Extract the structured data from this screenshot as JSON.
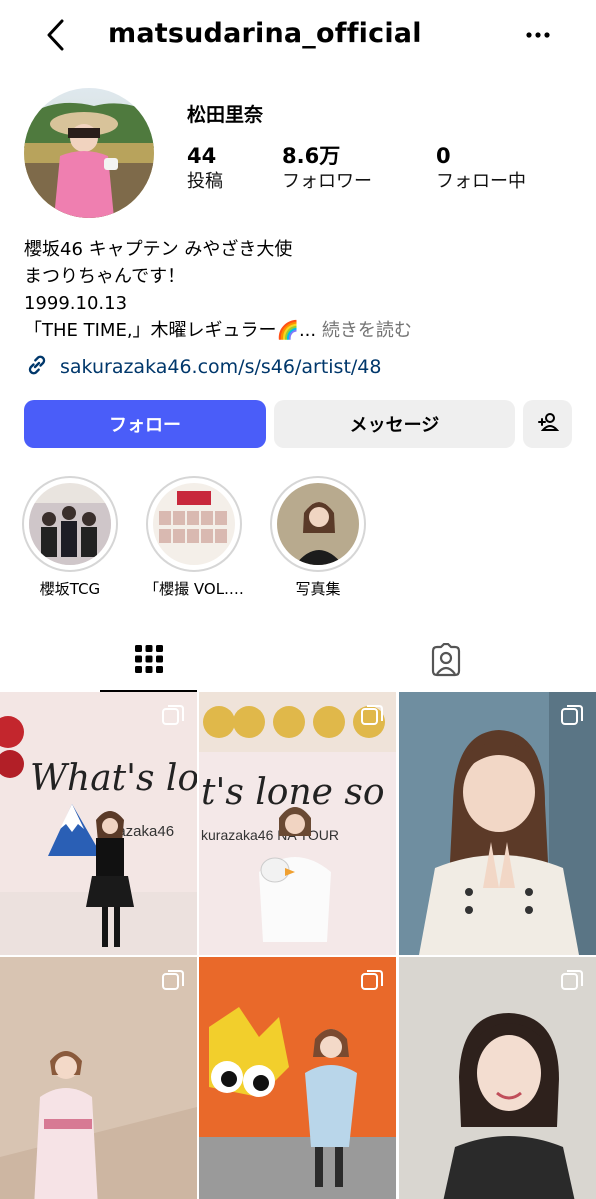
{
  "header": {
    "username": "matsudarina_official",
    "back_icon": "chevron-left-icon",
    "more_icon": "more-horizontal-icon"
  },
  "profile": {
    "display_name": "松田里奈",
    "stats": [
      {
        "value": "44",
        "label": "投稿"
      },
      {
        "value": "8.6万",
        "label": "フォロワー"
      },
      {
        "value": "0",
        "label": "フォロー中"
      }
    ],
    "bio_lines": [
      "櫻坂46 キャプテン みやざき大使",
      "まつりちゃんです！",
      "1999.10.13"
    ],
    "bio_last_line": "「THE TIME,」木曜レギュラー🌈...",
    "bio_more": "続きを読む",
    "link": "sakurazaka46.com/s/s46/artist/48"
  },
  "actions": {
    "follow": "フォロー",
    "message": "メッセージ",
    "add_person_icon": "add-person-icon"
  },
  "highlights": [
    {
      "label": "櫻坂TCG"
    },
    {
      "label": "「櫻撮 VOL.…"
    },
    {
      "label": "写真集"
    }
  ],
  "tabs": {
    "grid_icon": "grid-icon",
    "tagged_icon": "tagged-person-icon"
  },
  "posts": [
    {
      "overlay": "What's lo",
      "sub": "urazaka46",
      "multi": true
    },
    {
      "overlay": "t's lone so",
      "sub": "kurazaka46 NA TOUR",
      "multi": true
    },
    {
      "overlay": "",
      "sub": "",
      "multi": true
    },
    {
      "overlay": "",
      "sub": "",
      "multi": true
    },
    {
      "overlay": "",
      "sub": "",
      "multi": true
    },
    {
      "overlay": "",
      "sub": "",
      "multi": true
    }
  ],
  "colors": {
    "accent": "#4a5df9",
    "link": "#00376b",
    "muted": "#737373",
    "button_bg": "#efefef"
  }
}
